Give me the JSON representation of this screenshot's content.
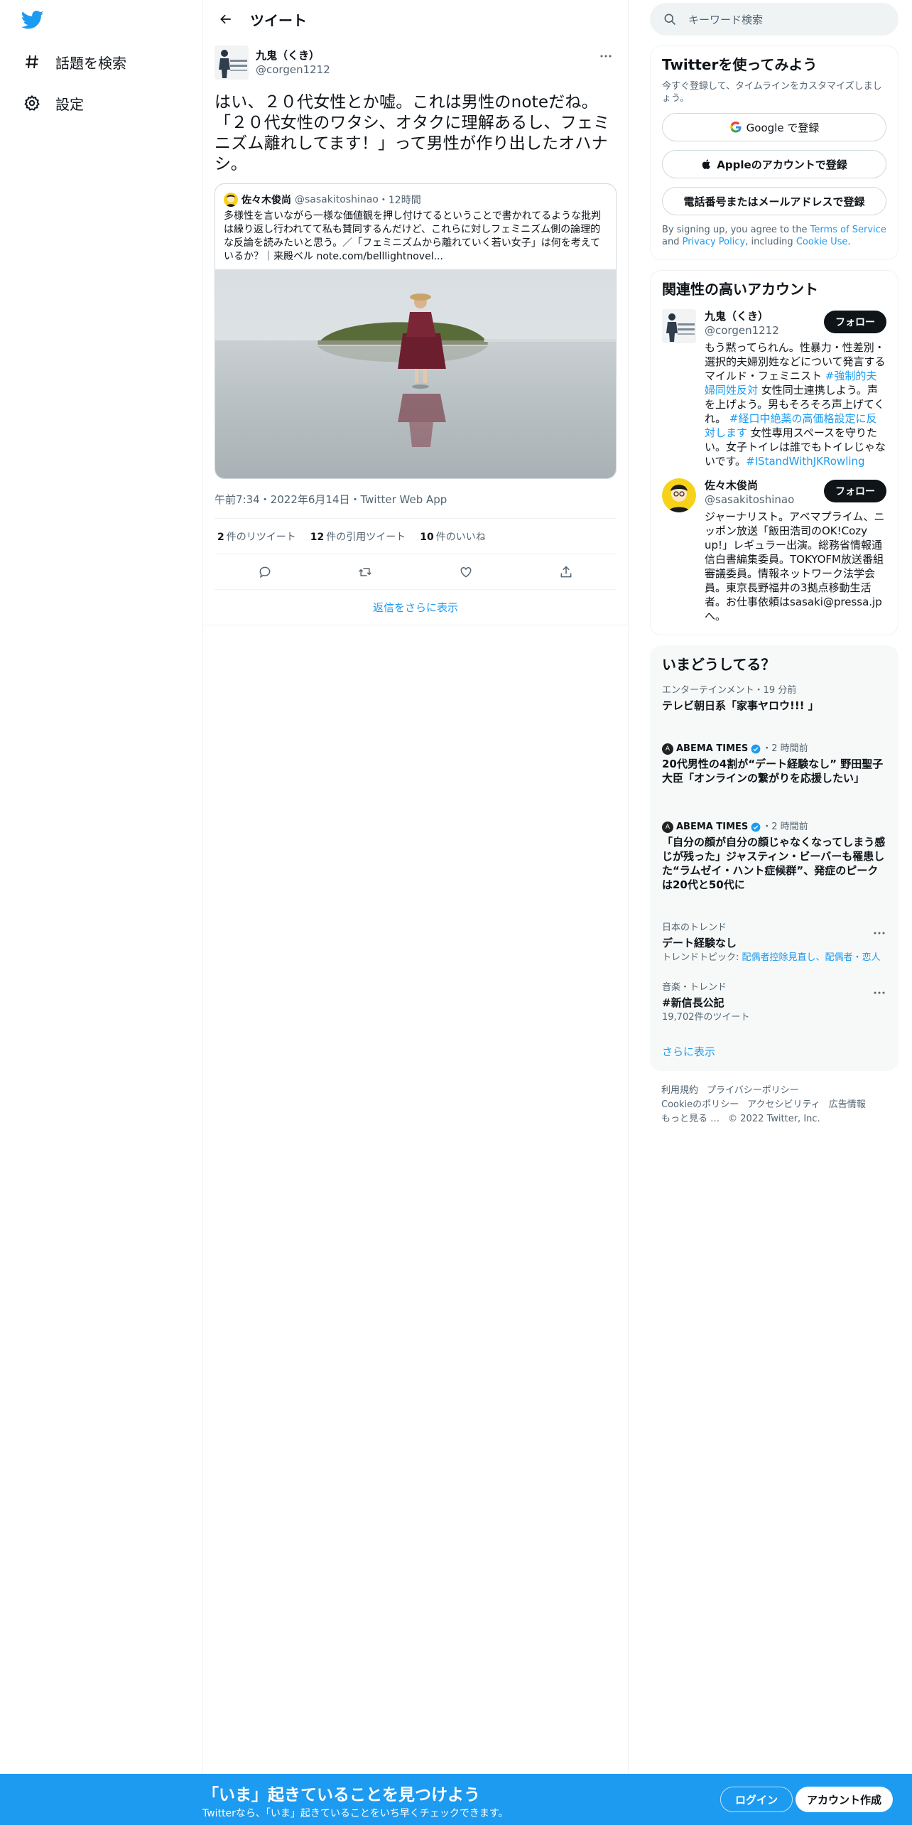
{
  "nav": {
    "explore": "話題を検索",
    "settings": "設定"
  },
  "header": {
    "title": "ツイート"
  },
  "tweet": {
    "name": "九鬼（くき）",
    "handle": "@corgen1212",
    "text": "はい、２０代女性とか嘘。これは男性のnoteだね。「２０代女性のワタシ、オタクに理解あるし、フェミニズム離れしてます！」って男性が作り出したオハナシ。",
    "quote": {
      "name": "佐々木俊尚",
      "handle": "@sasakitoshinao",
      "time": "・12時間",
      "text": "多様性を言いながら一様な価値観を押し付けてるということで書かれてるような批判は繰り返し行われてて私も賛同するんだけど、これらに対しフェミニズム側の論理的な反論を読みたいと思う。／「フェミニズムから離れていく若い女子」は何を考えているか？｜来殿ベル note.com/belllightnovel..."
    },
    "meta": "午前7:34・2022年6月14日・Twitter Web App",
    "stats": {
      "retweets_count": "2",
      "retweets_label": "件のリツイート",
      "quotes_count": "12",
      "quotes_label": "件の引用ツイート",
      "likes_count": "10",
      "likes_label": "件のいいね"
    },
    "show_more": "返信をさらに表示"
  },
  "search": {
    "placeholder": "キーワード検索"
  },
  "signup_card": {
    "title": "Twitterを使ってみよう",
    "subtitle": "今すぐ登録して、タイムラインをカスタマイズしましょう。",
    "google": "Google で登録",
    "apple": "Appleのアカウントで登録",
    "phone": "電話番号またはメールアドレスで登録",
    "terms_prefix": "By signing up, you agree to the ",
    "terms_link": "Terms of Service",
    "terms_and": " and ",
    "privacy_link": "Privacy Policy",
    "terms_including": ", including ",
    "cookie_link": "Cookie Use",
    "terms_end": "."
  },
  "relevant": {
    "title": "関連性の高いアカウント",
    "follow_label": "フォロー",
    "accounts": [
      {
        "name": "九鬼（くき）",
        "handle": "@corgen1212",
        "bio_1": "もう黙ってられん。性暴力・性差別・選択的夫婦別姓などについて発言するマイルド・フェミニスト ",
        "tag_1": "#強制的夫婦同姓反対",
        "bio_2": " 女性同士連携しよう。声を上げよう。男もそろそろ声上げてくれ。 ",
        "tag_2": "#経口中絶薬の高価格設定に反対します",
        "bio_3": " 女性専用スペースを守りたい。女子トイレは誰でもトイレじゃないです。",
        "tag_3": "#IStandWithJKRowling"
      },
      {
        "name": "佐々木俊尚",
        "handle": "@sasakitoshinao",
        "bio": "ジャーナリスト。アベマプライム、ニッポン放送「飯田浩司のOK!Cozy up!」レギュラー出演。総務省情報通信白書編集委員。TOKYOFM放送番組審議委員。情報ネットワーク法学会員。東京長野福井の3拠点移動生活者。お仕事依頼はsasaki@pressa.jpへ。"
      }
    ]
  },
  "trends": {
    "title": "いまどうしてる？",
    "items": [
      {
        "category": "エンターテインメント・19 分前",
        "headline": "テレビ朝日系「家事ヤロウ!!! 」"
      },
      {
        "source": "ABEMA TIMES",
        "time": "・2 時間前",
        "headline": "20代男性の4割が“デート経験なし” 野田聖子大臣「オンラインの繋がりを応援したい」"
      },
      {
        "source": "ABEMA TIMES",
        "time": "・2 時間前",
        "headline": "「自分の顔が自分の顔じゃなくなってしまう感じが残った」ジャスティン・ビーバーも罹患した“ラムゼイ・ハント症候群”、発症のピークは20代と50代に"
      },
      {
        "category": "日本のトレンド",
        "headline": "デート経験なし",
        "sub_prefix": "トレンドトピック: ",
        "sub_link": "配偶者控除見直し、配偶者・恋人"
      },
      {
        "category": "音楽・トレンド",
        "headline": "#新信長公記",
        "sub": "19,702件のツイート"
      }
    ],
    "show_more": "さらに表示"
  },
  "footer": {
    "terms": "利用規約",
    "privacy": "プライバシーポリシー",
    "cookie": "Cookieのポリシー",
    "accessibility": "アクセシビリティ",
    "ads": "広告情報",
    "more": "もっと見る …",
    "copyright": "© 2022 Twitter, Inc."
  },
  "banner": {
    "title": "「いま」起きていることを見つけよう",
    "subtitle": "Twitterなら、「いま」起きていることをいち早くチェックできます。",
    "login": "ログイン",
    "signup": "アカウント作成"
  },
  "colors": {
    "brand": "#1d9bf0",
    "text": "#0f1419",
    "muted": "#536471"
  }
}
